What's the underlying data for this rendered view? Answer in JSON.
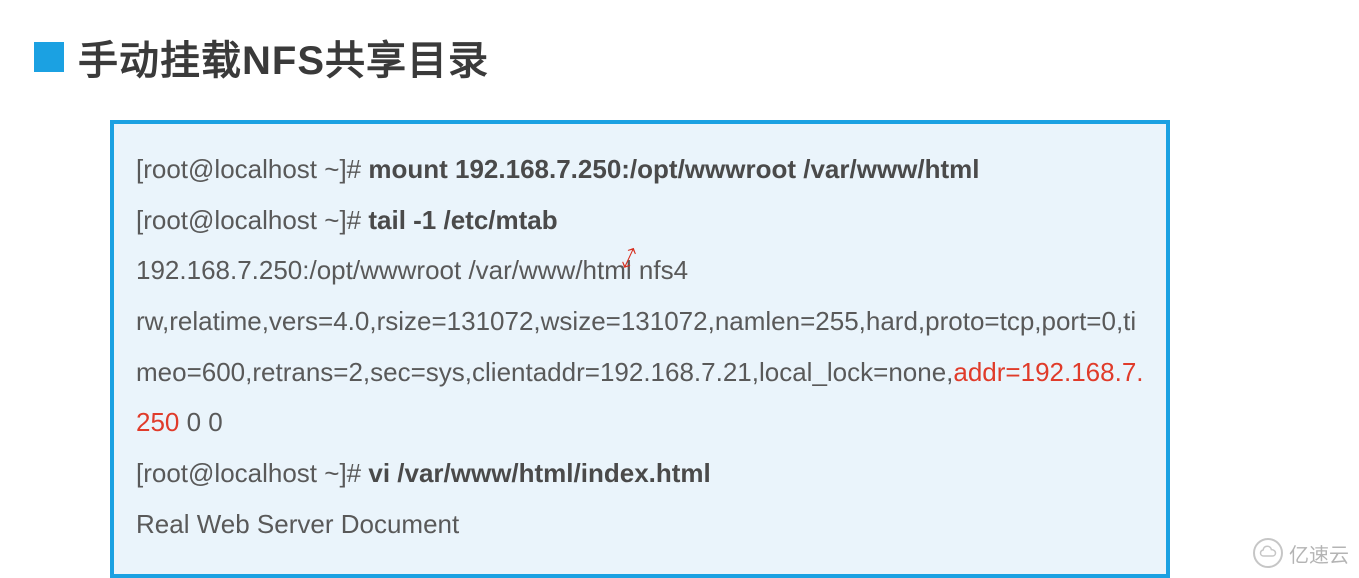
{
  "title": "手动挂载NFS共享目录",
  "lines": {
    "l1_prompt": "[root@localhost ~]# ",
    "l1_cmd": "mount 192.168.7.250:/opt/wwwroot /var/www/html",
    "l2_prompt": "[root@localhost ~]# ",
    "l2_cmd": "tail -1 /etc/mtab",
    "l3": "192.168.7.250:/opt/wwwroot /var/www/html nfs4",
    "l4a": "rw,relatime,vers=4.0,rsize=131072,wsize=131072,namlen=255,hard,proto=tcp,port=0,timeo=600,retrans=2,sec=sys,clientaddr=192.168.7.21,local_lock=none,",
    "l4_red": "addr=192.168.7.250",
    "l4b": " 0 0",
    "l5_prompt": "[root@localhost ~]# ",
    "l5_cmd": "vi /var/www/html/index.html",
    "l6": "Real Web Server Document"
  },
  "watermark": "亿速云",
  "annot_mark": "⤢"
}
